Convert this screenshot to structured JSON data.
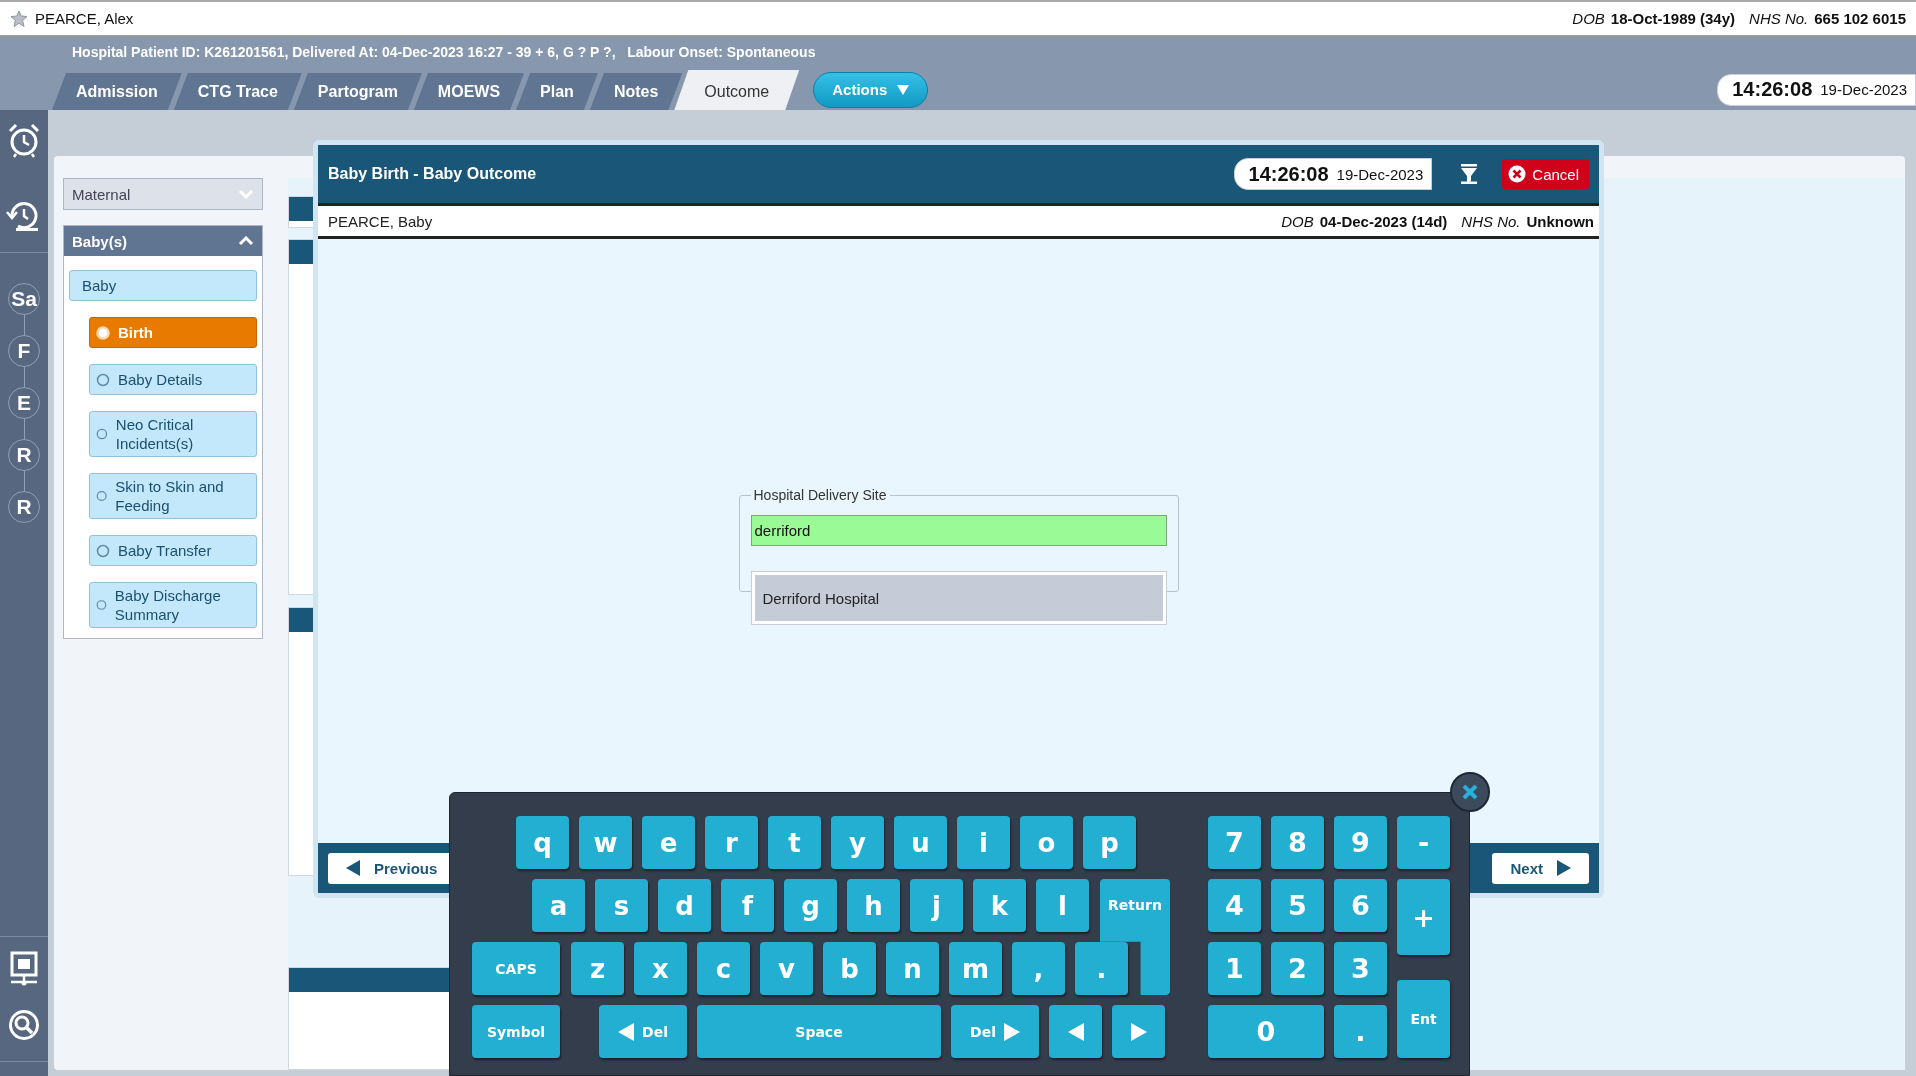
{
  "patient_bar": {
    "name": "PEARCE, Alex",
    "dob_label": "DOB",
    "dob": "18-Oct-1989 (34y)",
    "nhs_label": "NHS No.",
    "nhs": "665 102 6015"
  },
  "episode_info": "Hospital Patient ID: K261201561, Delivered At: 04-Dec-2023 16:27 - 39 + 6, G ? P ?,   Labour Onset: Spontaneous",
  "tabs": [
    {
      "label": "Admission",
      "selected": false
    },
    {
      "label": "CTG Trace",
      "selected": false
    },
    {
      "label": "Partogram",
      "selected": false
    },
    {
      "label": "MOEWS",
      "selected": false
    },
    {
      "label": "Plan",
      "selected": false
    },
    {
      "label": "Notes",
      "selected": false
    },
    {
      "label": "Outcome",
      "selected": true
    }
  ],
  "actions_button": "Actions",
  "clock": {
    "time": "14:26:08",
    "date": "19-Dec-2023"
  },
  "rail": {
    "stages": [
      "Sa",
      "F",
      "E",
      "R",
      "R"
    ]
  },
  "sidebar": {
    "maternal": {
      "label": "Maternal",
      "expanded": false
    },
    "babies": {
      "label": "Baby(s)",
      "expanded": true,
      "items": [
        {
          "label": "Baby",
          "children": [
            {
              "label": "Birth",
              "selected": true
            },
            {
              "label": "Baby Details",
              "selected": false
            },
            {
              "label": "Neo Critical Incidents(s)",
              "selected": false
            },
            {
              "label": "Skin to Skin and Feeding",
              "selected": false
            },
            {
              "label": "Baby Transfer",
              "selected": false
            },
            {
              "label": "Baby Discharge Summary",
              "selected": false
            }
          ]
        }
      ]
    }
  },
  "dialog": {
    "title": "Baby Birth - Baby Outcome",
    "time": "14:26:08",
    "date": "19-Dec-2023",
    "cancel": "Cancel",
    "patient": {
      "name": "PEARCE, Baby",
      "dob_label": "DOB",
      "dob": "04-Dec-2023 (14d)",
      "nhs_label": "NHS No.",
      "nhs": "Unknown"
    },
    "field": {
      "label": "Hospital Delivery Site",
      "value": "derriford",
      "suggestions": [
        "Derriford Hospital"
      ]
    },
    "previous": "Previous",
    "next": "Next"
  },
  "keyboard": {
    "top_row": [
      {
        "label": "q",
        "kind": "letter"
      },
      {
        "label": "w",
        "kind": "letter"
      },
      {
        "label": "e",
        "kind": "letter"
      },
      {
        "label": "r",
        "kind": "letter"
      },
      {
        "label": "t",
        "kind": "letter"
      },
      {
        "label": "y",
        "kind": "letter"
      },
      {
        "label": "u",
        "kind": "letter"
      },
      {
        "label": "i",
        "kind": "letter"
      },
      {
        "label": "o",
        "kind": "letter"
      },
      {
        "label": "p",
        "kind": "letter"
      }
    ],
    "home_row": [
      {
        "label": "a",
        "kind": "letter"
      },
      {
        "label": "s",
        "kind": "letter"
      },
      {
        "label": "d",
        "kind": "letter"
      },
      {
        "label": "f",
        "kind": "letter"
      },
      {
        "label": "g",
        "kind": "letter"
      },
      {
        "label": "h",
        "kind": "letter"
      },
      {
        "label": "j",
        "kind": "letter"
      },
      {
        "label": "k",
        "kind": "letter"
      },
      {
        "label": "l",
        "kind": "letter"
      },
      {
        "label": "Return",
        "kind": "return"
      }
    ],
    "lower_row": [
      {
        "label": "CAPS",
        "kind": "wide"
      },
      {
        "label": "z",
        "kind": "letter"
      },
      {
        "label": "x",
        "kind": "letter"
      },
      {
        "label": "c",
        "kind": "letter"
      },
      {
        "label": "v",
        "kind": "letter"
      },
      {
        "label": "b",
        "kind": "letter"
      },
      {
        "label": "n",
        "kind": "letter"
      },
      {
        "label": "m",
        "kind": "letter"
      },
      {
        "label": ",",
        "kind": "letter"
      },
      {
        "label": ".",
        "kind": "letter"
      }
    ],
    "bottom_row": [
      {
        "label": "Symbol",
        "kind": "wide"
      },
      {
        "label": "Del",
        "kind": "del-back"
      },
      {
        "label": "Space",
        "kind": "space"
      },
      {
        "label": "Del",
        "kind": "del-forward"
      },
      {
        "kind": "arrow-left"
      },
      {
        "kind": "arrow-right"
      }
    ],
    "numpad": [
      {
        "label": "7",
        "kind": "num"
      },
      {
        "label": "8",
        "kind": "num"
      },
      {
        "label": "9",
        "kind": "num"
      },
      {
        "label": "-",
        "kind": "num"
      },
      {
        "label": "4",
        "kind": "num"
      },
      {
        "label": "5",
        "kind": "num"
      },
      {
        "label": "6",
        "kind": "num"
      },
      {
        "label": "+",
        "kind": "plus"
      },
      {
        "label": "1",
        "kind": "num"
      },
      {
        "label": "2",
        "kind": "num"
      },
      {
        "label": "3",
        "kind": "num"
      },
      {
        "label": "Ent",
        "kind": "enter"
      },
      {
        "label": "0",
        "kind": "zero"
      },
      {
        "label": ".",
        "kind": "num"
      }
    ]
  }
}
